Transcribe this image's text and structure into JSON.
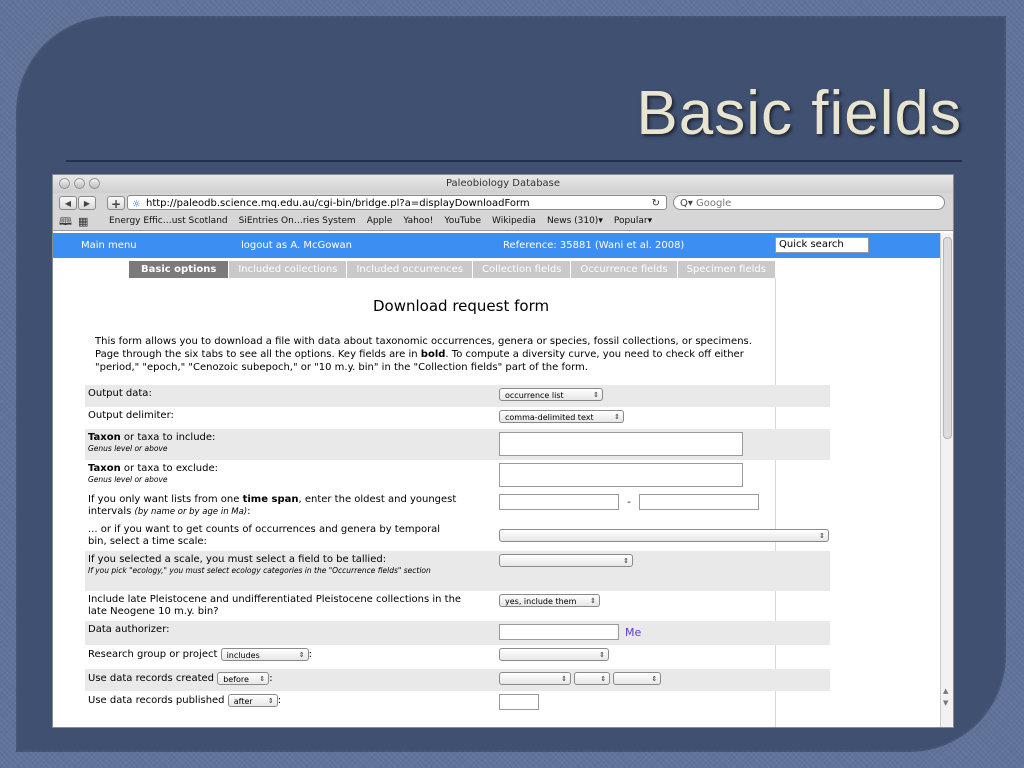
{
  "slide": {
    "title": "Basic fields"
  },
  "browser": {
    "window_title": "Paleobiology Database",
    "url": "http://paleodb.science.mq.edu.au/cgi-bin/bridge.pl?a=displayDownloadForm",
    "search_placeholder": "Google",
    "bookmarks": [
      "Energy Effic…ust Scotland",
      "SiEntries On…ries System",
      "Apple",
      "Yahoo!",
      "YouTube",
      "Wikipedia",
      "News (310)▾",
      "Popular▾"
    ]
  },
  "page": {
    "topbar": {
      "main_menu": "Main menu",
      "logout": "logout as A. McGowan",
      "reference": "Reference: 35881 (Wani et al. 2008)",
      "quick_search": "Quick search"
    },
    "tabs": [
      "Basic options",
      "Included collections",
      "Included occurrences",
      "Collection fields",
      "Occurrence fields",
      "Specimen fields"
    ],
    "form_title": "Download request form",
    "intro_1": "This form allows you to download a file with data about taxonomic occurrences, genera or species, fossil collections, or specimens.",
    "intro_2a": "Page through the six tabs to see all the options. Key fields are in ",
    "intro_2b": "bold",
    "intro_2c": ". To compute a diversity curve, you need to check off either",
    "intro_3": "\"period,\" \"epoch,\" \"Cenozoic subepoch,\" or \"10 m.y. bin\" in the \"Collection fields\" part of the form.",
    "fields": {
      "output_data": {
        "label": "Output data:",
        "value": "occurrence list"
      },
      "output_delim": {
        "label": "Output delimiter:",
        "value": "comma-delimited text"
      },
      "taxon_include": {
        "bold": "Taxon",
        "label": " or taxa to include:",
        "sub": "Genus level or above"
      },
      "taxon_exclude": {
        "bold": "Taxon",
        "label": " or taxa to exclude:",
        "sub": "Genus level or above"
      },
      "time_span": {
        "pre": "If you only want lists from one ",
        "bold": "time span",
        "post": ", enter the oldest and youngest",
        "line2": "intervals ",
        "sub": "(by name or by age in Ma)",
        "colon": ":",
        "dash": "-"
      },
      "time_scale": {
        "line1": "... or if you want to get counts of occurrences and genera by temporal",
        "line2": "bin, select a time scale:"
      },
      "tally": {
        "label": "If you selected a scale, you must select a field to be tallied:",
        "sub": "If you pick \"ecology,\" you must select ecology categories in the \"Occurrence fields\" section"
      },
      "pleistocene": {
        "line1": "Include late Pleistocene and undifferentiated Pleistocene collections in the",
        "line2": "late Neogene 10 m.y. bin?",
        "value": "yes, include them"
      },
      "authorizer": {
        "label": "Data authorizer:",
        "me": "Me"
      },
      "research_group": {
        "label": "Research group or project",
        "value": "includes",
        "colon": ":"
      },
      "created": {
        "label": "Use data records created",
        "value": "before",
        "colon": ":"
      },
      "published": {
        "label": "Use data records published",
        "value": "after",
        "colon": ":"
      }
    }
  }
}
